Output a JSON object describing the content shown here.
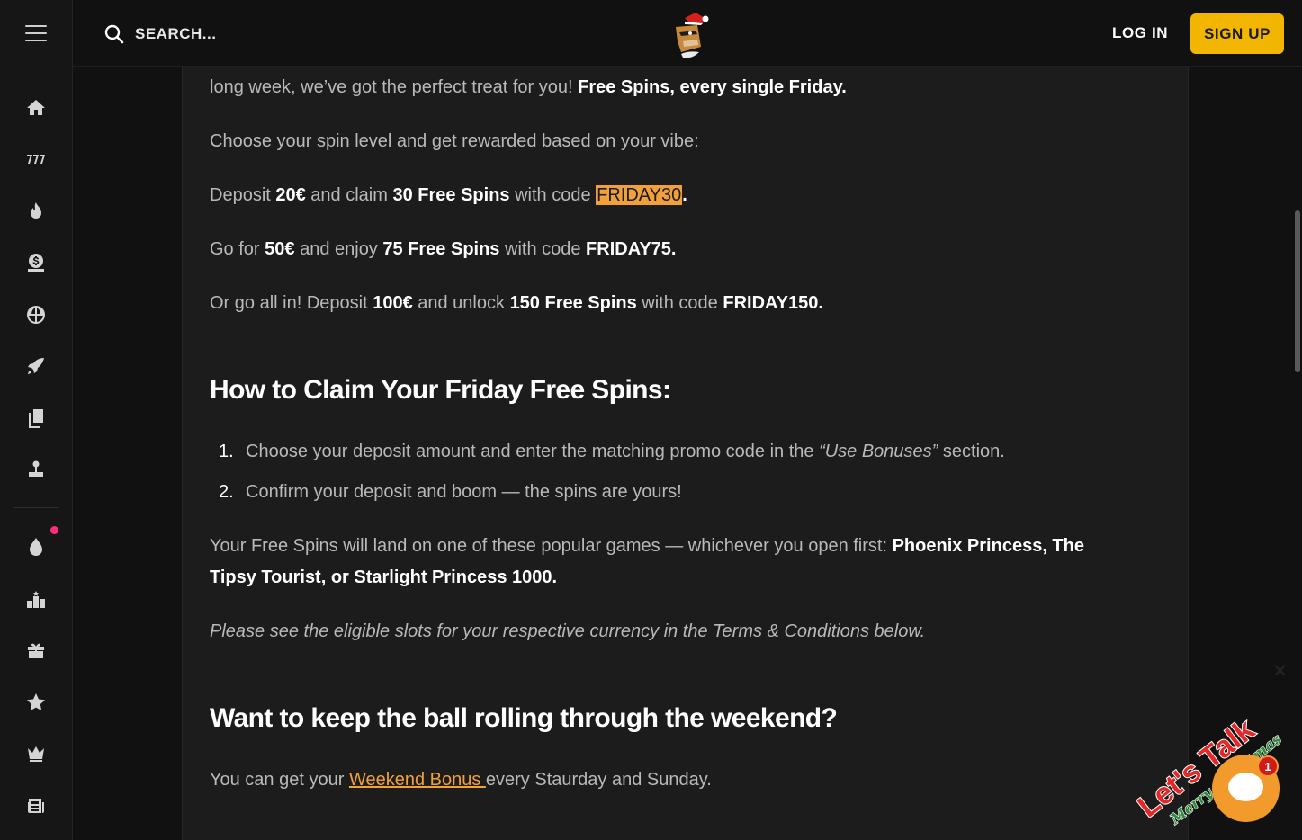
{
  "header": {
    "search_placeholder": "SEARCH...",
    "login_label": "LOG IN",
    "signup_label": "SIGN UP",
    "accent_color": "#f2b500"
  },
  "sidebar": {
    "icons": [
      "menu-icon",
      "home-icon",
      "slots-777-icon",
      "fire-icon",
      "money-bag-icon",
      "basketball-icon",
      "rocket-icon",
      "cards-icon",
      "joystick-icon",
      "drop-icon",
      "podium-icon",
      "gift-icon",
      "star-icon",
      "crown-icon",
      "news-icon"
    ]
  },
  "article": {
    "p1_start": "long week, we’ve got the perfect treat for you! ",
    "p1_bold": "Free Spins, every single Friday.",
    "p2": "Choose your spin level and get rewarded based on your vibe:",
    "t1": {
      "a": "Deposit ",
      "b": "20€",
      "c": " and claim ",
      "d": "30 Free Spins",
      "e": " with code ",
      "code": "FRIDAY30",
      "end": "."
    },
    "t2": {
      "a": "Go for ",
      "b": "50€",
      "c": " and enjoy ",
      "d": "75 Free Spins",
      "e": " with code ",
      "code": "FRIDAY75."
    },
    "t3": {
      "a": "Or go all in! Deposit ",
      "b": "100€",
      "c": " and unlock ",
      "d": "150 Free Spins",
      "e": " with code ",
      "code": "FRIDAY150."
    },
    "h2_claim": "How to Claim Your Friday Free Spins:",
    "steps": [
      {
        "num": "1.",
        "text_a": "Choose your deposit amount and enter the matching promo code in the ",
        "text_em": "“Use Bonuses”",
        "text_b": " section."
      },
      {
        "num": "2.",
        "text_a": "Confirm your deposit and boom — the spins are yours!"
      }
    ],
    "games_intro": "Your Free Spins will land on one of these popular games — whichever you open first: ",
    "games_bold_1": "Phoenix Princess, The",
    "games_bold_2": "Tipsy Tourist, or Starlight Princess 1000.",
    "eligible_note": "Please see the eligible slots for your respective currency in the Terms & Conditions below.",
    "h2_weekend": "Want to keep the ball rolling through the weekend?",
    "weekend_a": "You can get your ",
    "weekend_link": "Weekend Bonus ",
    "weekend_b": "every Staurday and Sunday."
  },
  "chat": {
    "badge_count": "1",
    "close_label": "✕",
    "banner_text": "Let's Talk",
    "banner_sub": "Merry Christmas"
  }
}
